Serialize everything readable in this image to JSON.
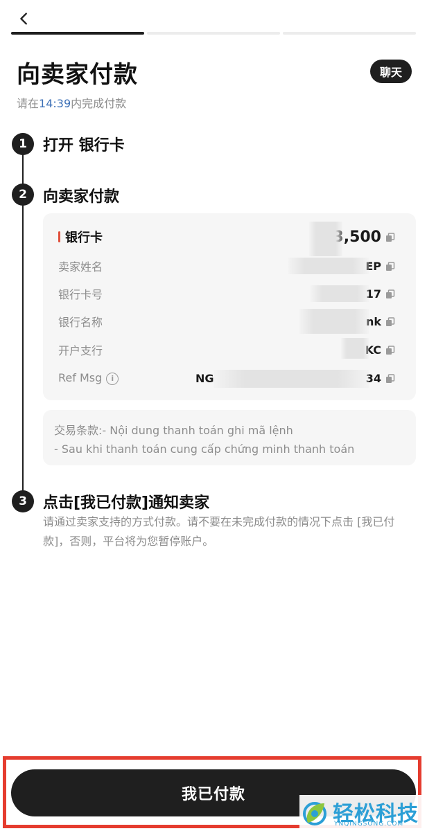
{
  "header": {
    "back_icon": "chevron-left-icon",
    "progress": {
      "total": 3,
      "active": 1
    },
    "title": "向卖家付款",
    "chat_label": "聊天",
    "countdown_prefix": "请在",
    "countdown_time": "14:39",
    "countdown_suffix": "内完成付款"
  },
  "steps": [
    {
      "number": "1",
      "title": "打开 银行卡"
    },
    {
      "number": "2",
      "title": "向卖家付款"
    },
    {
      "number": "3",
      "title": "点击[我已付款]通知卖家",
      "description": "请通过卖家支持的方式付款。请不要在未完成付款的情况下点击 [我已付款]，否则，平台将为您暂停账户。"
    }
  ],
  "payment_card": {
    "method": "银行卡",
    "amount": "₫ 3,500",
    "rows": [
      {
        "label": "卖家姓名",
        "value": "EP"
      },
      {
        "label": "银行卡号",
        "value": "17"
      },
      {
        "label": "银行名称",
        "value": "nk"
      },
      {
        "label": "开户支行",
        "value": "KC"
      },
      {
        "label": "Ref Msg",
        "value_prefix": "NG",
        "value": "34"
      }
    ]
  },
  "terms": {
    "line1": "交易条款:- Nội dung thanh toán ghi mã lệnh",
    "line2": "- Sau khi thanh toán cung cấp chứng minh thanh toán"
  },
  "cta": {
    "label": "我已付款"
  },
  "watermark": {
    "text": "轻松科技",
    "sub": "YNQINGSONG.COM"
  },
  "colors": {
    "primary_dark": "#1f1f1f",
    "timer_blue": "#3b6fb6",
    "accent_red": "#e53c2f",
    "watermark_blue": "#2c9fd6"
  }
}
